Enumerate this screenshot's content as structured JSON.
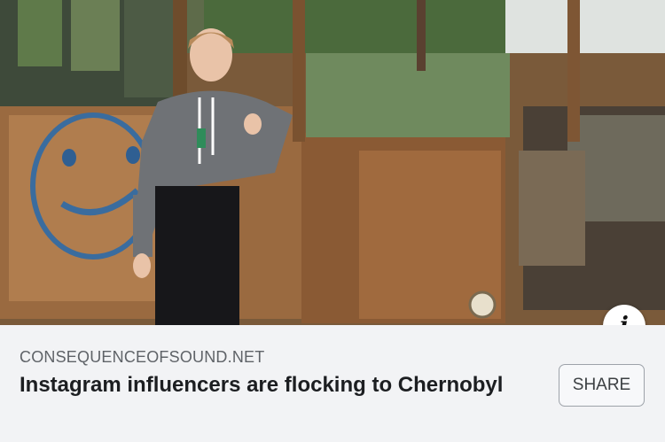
{
  "link_preview": {
    "domain": "CONSEQUENCEOFSOUND.NET",
    "headline": "Instagram influencers are flocking to Chernobyl",
    "share_label": "SHARE",
    "info_glyph": "i"
  },
  "icons": {
    "info": "info-icon"
  }
}
